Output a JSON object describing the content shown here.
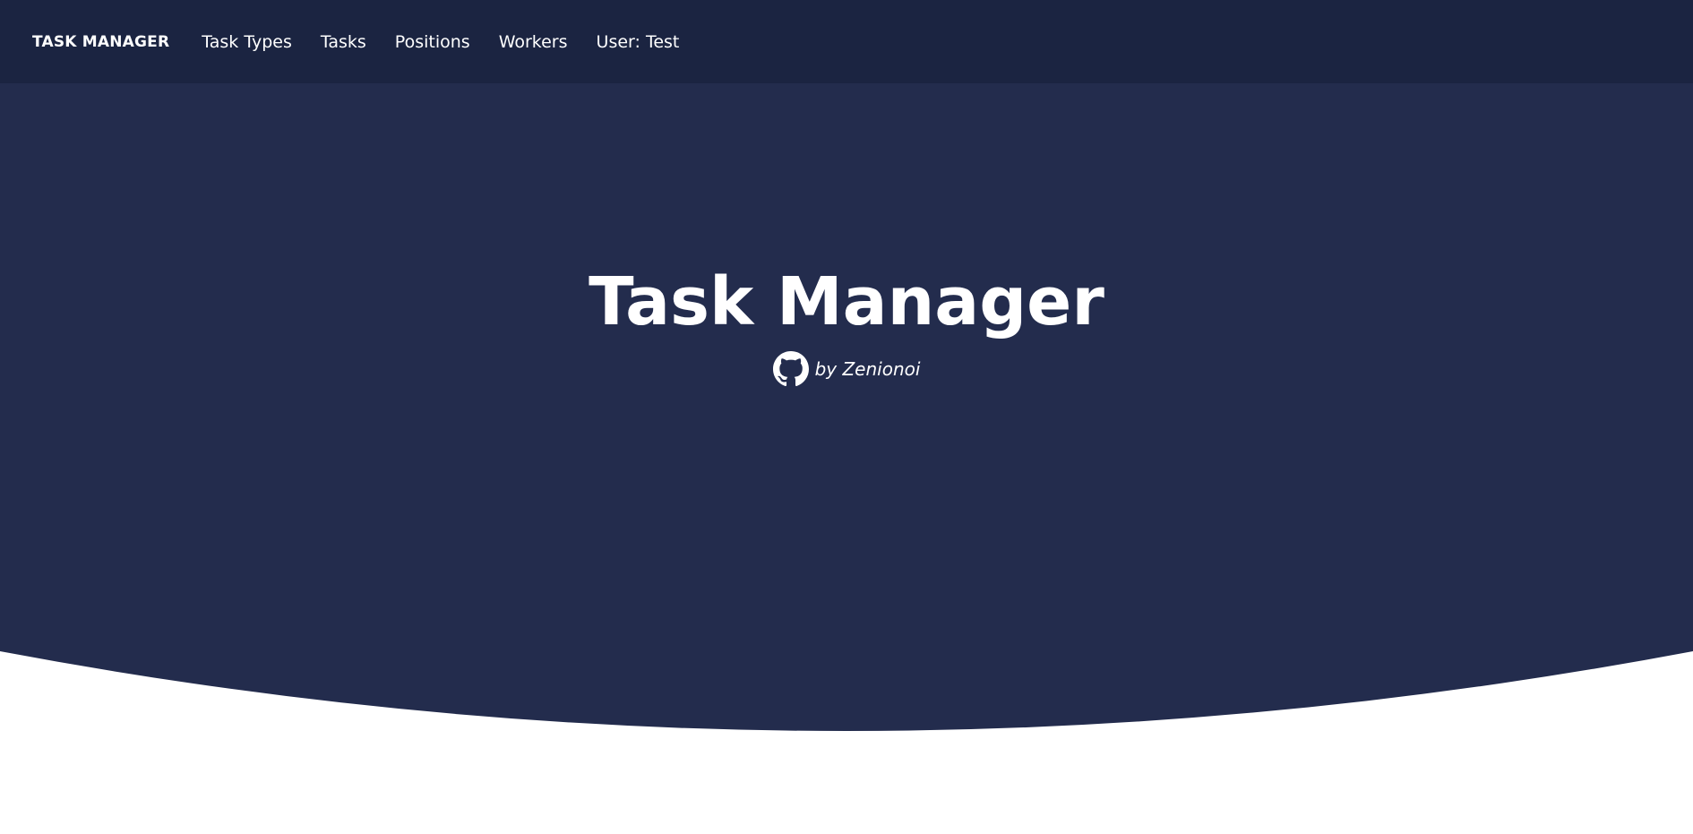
{
  "nav": {
    "brand": "TASK MANAGER",
    "links": [
      "Task Types",
      "Tasks",
      "Positions",
      "Workers",
      "User: Test"
    ]
  },
  "hero": {
    "title": "Task Manager",
    "byline": "by Zenionoi",
    "byline_icon": "github-icon"
  },
  "colors": {
    "navbar_bg": "#1b2441",
    "hero_bg": "#232c4d",
    "text": "#ffffff",
    "page_bg": "#ffffff"
  }
}
